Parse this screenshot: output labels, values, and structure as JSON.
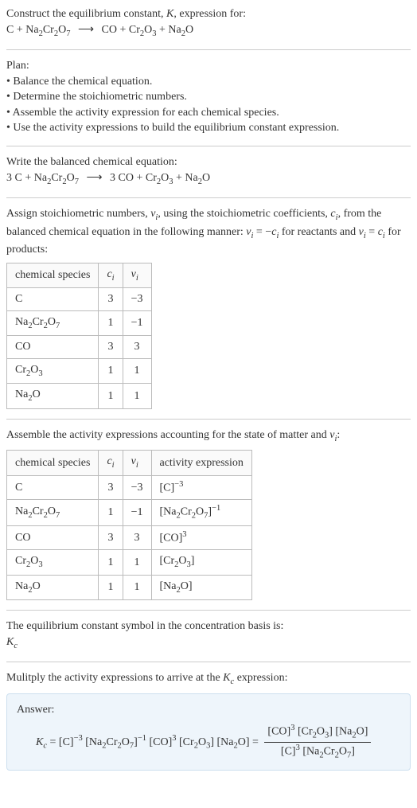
{
  "intro": {
    "line1_a": "Construct the equilibrium constant, ",
    "line1_K": "K",
    "line1_b": ", expression for:",
    "eq_lhs_a": "C + Na",
    "eq_lhs_b": "Cr",
    "eq_lhs_c": "O",
    "arrow": "⟶",
    "eq_rhs_a": "CO + Cr",
    "eq_rhs_b": "O",
    "eq_rhs_c": " + Na",
    "eq_rhs_d": "O",
    "s2": "2",
    "s3": "3",
    "s7": "7"
  },
  "plan": {
    "title": "Plan:",
    "b1": "• Balance the chemical equation.",
    "b2": "• Determine the stoichiometric numbers.",
    "b3": "• Assemble the activity expression for each chemical species.",
    "b4": "• Use the activity expressions to build the equilibrium constant expression."
  },
  "balanced": {
    "title": "Write the balanced chemical equation:",
    "lhs_a": "3 C + Na",
    "lhs_b": "Cr",
    "lhs_c": "O",
    "arrow": "⟶",
    "rhs_a": "3 CO + Cr",
    "rhs_b": "O",
    "rhs_c": " + Na",
    "rhs_d": "O",
    "s2": "2",
    "s3": "3",
    "s7": "7"
  },
  "stoich": {
    "p1_a": "Assign stoichiometric numbers, ",
    "p1_nu": "ν",
    "p1_i": "i",
    "p1_b": ", using the stoichiometric coefficients, ",
    "p1_c": "c",
    "p1_d": ", from the balanced chemical equation in the following manner: ",
    "p1_e": " = −",
    "p1_f": " for reactants and ",
    "p1_g": " = ",
    "p1_h": " for products:",
    "h1": "chemical species",
    "h2_c": "c",
    "h2_i": "i",
    "h3_nu": "ν",
    "h3_i": "i",
    "r1_s": "C",
    "r1_c": "3",
    "r1_v": "−3",
    "r2_a": "Na",
    "r2_b": "Cr",
    "r2_c": "O",
    "r2_ci": "1",
    "r2_v": "−1",
    "r3_s": "CO",
    "r3_c": "3",
    "r3_v": "3",
    "r4_a": "Cr",
    "r4_b": "O",
    "r4_c": "1",
    "r4_v": "1",
    "r5_a": "Na",
    "r5_b": "O",
    "r5_c": "1",
    "r5_v": "1",
    "s2": "2",
    "s3": "3",
    "s7": "7"
  },
  "activity": {
    "p1_a": "Assemble the activity expressions accounting for the state of matter and ",
    "p1_nu": "ν",
    "p1_i": "i",
    "p1_b": ":",
    "h1": "chemical species",
    "h2_c": "c",
    "h2_i": "i",
    "h3_nu": "ν",
    "h3_i": "i",
    "h4": "activity expression",
    "r1_s": "C",
    "r1_c": "3",
    "r1_v": "−3",
    "r1_ae": "[C]",
    "r1_exp": "−3",
    "r2_a": "Na",
    "r2_b": "Cr",
    "r2_c": "O",
    "r2_ci": "1",
    "r2_v": "−1",
    "r2_ae_a": "[Na",
    "r2_ae_b": "Cr",
    "r2_ae_c": "O",
    "r2_ae_d": "]",
    "r2_exp": "−1",
    "r3_s": "CO",
    "r3_c": "3",
    "r3_v": "3",
    "r3_ae": "[CO]",
    "r3_exp": "3",
    "r4_a": "Cr",
    "r4_b": "O",
    "r4_c": "1",
    "r4_v": "1",
    "r4_ae_a": "[Cr",
    "r4_ae_b": "O",
    "r4_ae_c": "]",
    "r5_a": "Na",
    "r5_b": "O",
    "r5_c": "1",
    "r5_v": "1",
    "r5_ae_a": "[Na",
    "r5_ae_b": "O]",
    "s2": "2",
    "s3": "3",
    "s7": "7"
  },
  "kc_symbol": {
    "p1": "The equilibrium constant symbol in the concentration basis is:",
    "K": "K",
    "c": "c"
  },
  "multiply": {
    "p1_a": "Mulitply the activity expressions to arrive at the ",
    "p1_K": "K",
    "p1_c": "c",
    "p1_b": " expression:"
  },
  "answer": {
    "label": "Answer:",
    "Kc_K": "K",
    "Kc_c": "c",
    "eq": " = ",
    "t1": "[C]",
    "e1": "−3",
    "t2_a": " [Na",
    "t2_b": "Cr",
    "t2_c": "O",
    "t2_d": "]",
    "e2": "−1",
    "t3": " [CO]",
    "e3": "3",
    "t4_a": " [Cr",
    "t4_b": "O",
    "t4_c": "]",
    "t5_a": " [Na",
    "t5_b": "O] = ",
    "num_a": "[CO]",
    "num_e": "3",
    "num_b": " [Cr",
    "num_c": "O",
    "num_d": "] [Na",
    "num_e2": "O]",
    "den_a": "[C]",
    "den_e": "3",
    "den_b": " [Na",
    "den_c": "Cr",
    "den_d": "O",
    "den_e2": "]",
    "s2": "2",
    "s3": "3",
    "s7": "7"
  }
}
